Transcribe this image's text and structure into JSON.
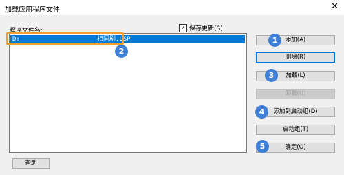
{
  "window": {
    "title": "加载应用程序文件",
    "close_glyph": "✕"
  },
  "list": {
    "label": "程序文件名:",
    "selected_item": {
      "drive": "D:",
      "name": "相同剧.LSP"
    }
  },
  "save_changes": {
    "label": "保存更新(S)",
    "checked": true,
    "check_glyph": "✓"
  },
  "buttons": {
    "add": "添加(A)",
    "delete": "删除(R)",
    "load": "加载(L)",
    "unload": "卸载(U)",
    "add_to_startup": "添加到启动组(D)",
    "startup_group": "启动组(T)",
    "ok": "确定(O)",
    "help": "帮助"
  },
  "callouts": [
    "1",
    "2",
    "3",
    "4",
    "5"
  ]
}
